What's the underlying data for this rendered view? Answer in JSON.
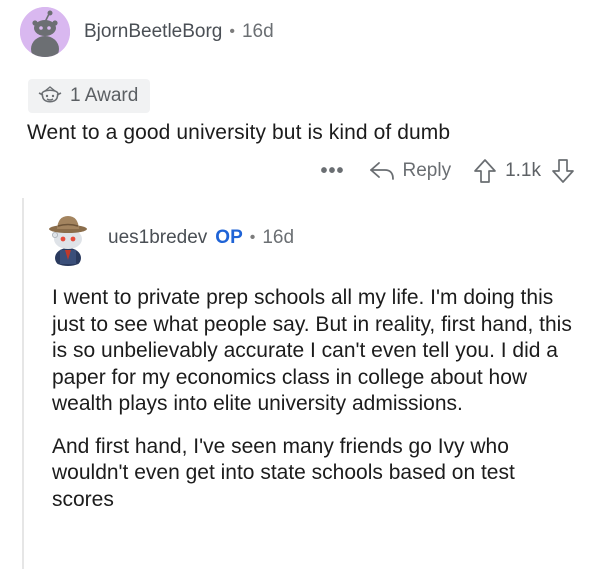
{
  "comment": {
    "username": "BjornBeetleBorg",
    "separator": "•",
    "age": "16d",
    "award_label": "1 Award",
    "body": "Went to a good university but is kind of dumb",
    "actions": {
      "more": "•••",
      "reply_label": "Reply",
      "score": "1.1k"
    }
  },
  "reply": {
    "username": "ues1bredev",
    "op_badge": "OP",
    "separator": "•",
    "age": "16d",
    "paragraphs": [
      "I went to private prep schools all my life. I'm doing this just to see what people say. But in reality, first hand, this is so unbelievably accurate I can't even tell you. I did a paper for my economics class in college about how wealth plays into elite university admissions.",
      "And first hand, I've seen many friends go Ivy who wouldn't even get into state schools based on test scores"
    ]
  },
  "colors": {
    "op_badge": "#1f63d6",
    "avatar_bg": "#d9b8f0",
    "muted_text": "#6a6e72"
  },
  "icons": [
    "snoo-avatar-icon",
    "award-icon",
    "more-options-icon",
    "reply-arrow-icon",
    "upvote-arrow-icon",
    "downvote-arrow-icon",
    "snoo-explorer-avatar-icon"
  ]
}
